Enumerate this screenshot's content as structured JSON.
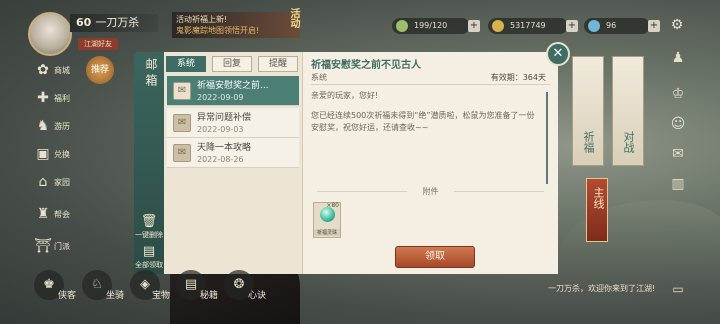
{
  "player": {
    "level": "60",
    "name": "一刀万杀",
    "tag": "江湖好友"
  },
  "event": {
    "line1": "活动祈福上新!",
    "line2": "鬼影魔踪地图领悟开启!",
    "tag": "活动"
  },
  "resources": [
    {
      "value": "199/120",
      "icon": "stamina-icon",
      "color": "#9bbf6a"
    },
    {
      "value": "5317749",
      "icon": "coin-icon",
      "color": "#d9b24c"
    },
    {
      "value": "96",
      "icon": "gem-icon",
      "color": "#6fb6d9"
    }
  ],
  "sidebar": {
    "items": [
      {
        "label": "商城",
        "icon": "shop-icon"
      },
      {
        "label": "福利",
        "icon": "gift-icon"
      },
      {
        "label": "游历",
        "icon": "travel-icon"
      },
      {
        "label": "兑换",
        "icon": "exchange-icon"
      },
      {
        "label": "家园",
        "icon": "home-icon"
      },
      {
        "label": "帮会",
        "icon": "guild-icon"
      },
      {
        "label": "门派",
        "icon": "sect-icon"
      }
    ],
    "recommend": "推荐"
  },
  "mailbox": {
    "title": "邮箱",
    "tabs": [
      "系统",
      "回复",
      "提醒"
    ],
    "active_tab": "系统",
    "delete_all": "一键删除",
    "claim_all": "全部领取",
    "items": [
      {
        "title": "祈福安慰奖之前...",
        "date": "2022-09-09",
        "selected": true
      },
      {
        "title": "异常问题补偿",
        "date": "2022-09-03",
        "selected": false
      },
      {
        "title": "天降一本攻略",
        "date": "2022-08-26",
        "selected": false
      }
    ]
  },
  "detail": {
    "title": "祈福安慰奖之前不见古人",
    "from": "系统",
    "valid": "有效期：364天",
    "greeting": "亲爱的玩家，您好!",
    "body": "您已经连续500次祈福未得到“绝”潜质啦，松鼠为您准备了一份安慰奖，祝您好运，还请查收~~",
    "attachment_label": "附件",
    "attachment": {
      "name": "祈福灵珠",
      "count": "×80"
    },
    "claim_label": "领取"
  },
  "right": {
    "banners": [
      "祈福",
      "对战"
    ],
    "main_quest": "主线"
  },
  "bottom": {
    "items": [
      {
        "label": "侠客",
        "icon": "hero-icon"
      },
      {
        "label": "坐骑",
        "icon": "mount-icon"
      },
      {
        "label": "宝物",
        "icon": "treasure-icon"
      },
      {
        "label": "秘籍",
        "icon": "book-icon"
      },
      {
        "label": "心诀",
        "icon": "mind-icon"
      }
    ],
    "chat": "一刀万杀，欢迎你来到了江湖!"
  }
}
